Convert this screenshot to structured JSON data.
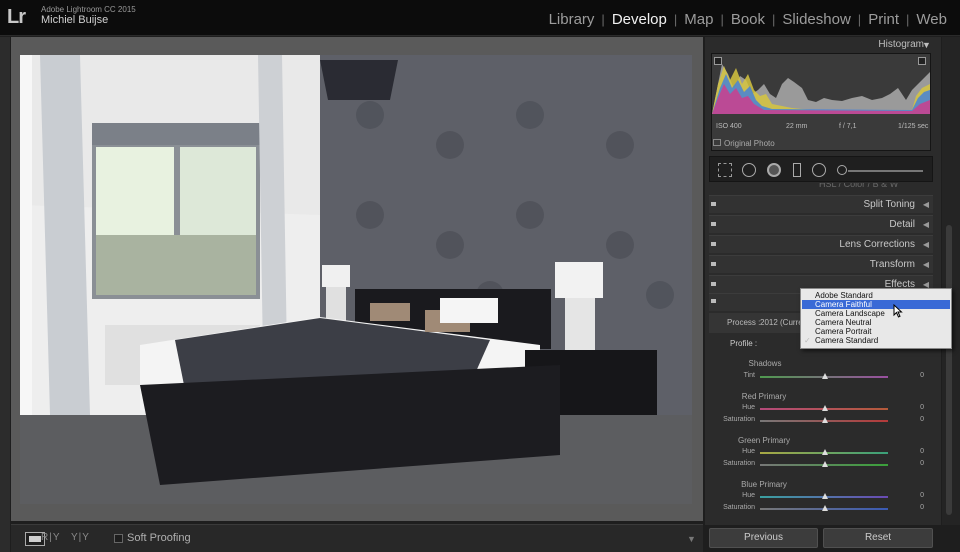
{
  "app": {
    "logo": "Lr",
    "name": "Adobe Lightroom CC 2015",
    "user": "Michiel Buijse"
  },
  "modules": [
    {
      "label": "Library",
      "active": false
    },
    {
      "label": "Develop",
      "active": true
    },
    {
      "label": "Map",
      "active": false
    },
    {
      "label": "Book",
      "active": false
    },
    {
      "label": "Slideshow",
      "active": false
    },
    {
      "label": "Print",
      "active": false
    },
    {
      "label": "Web",
      "active": false
    }
  ],
  "module_separator": "|",
  "toolbar": {
    "ry_label": "R|Y",
    "yy_label": "Y|Y",
    "soft_proofing": "Soft Proofing"
  },
  "histogram": {
    "title": "Histogram",
    "iso": "ISO 400",
    "focal": "22 mm",
    "aperture": "f / 7,1",
    "shutter": "1/125 sec",
    "original_photo": "Original Photo"
  },
  "hsl_tabs": "HSL  /  Color  /  B & W",
  "sections": [
    "Split Toning",
    "Detail",
    "Lens Corrections",
    "Transform",
    "Effects"
  ],
  "calibration": {
    "process_label": "Process :",
    "process_value": "2012 (Current)",
    "profile_label": "Profile :",
    "shadows_title": "Shadows",
    "tint_label": "Tint",
    "tint_value": "0",
    "red_title": "Red Primary",
    "red_hue_label": "Hue",
    "red_hue_value": "0",
    "red_sat_label": "Saturation",
    "red_sat_value": "0",
    "green_title": "Green Primary",
    "green_hue_label": "Hue",
    "green_hue_value": "0",
    "green_sat_label": "Saturation",
    "green_sat_value": "0",
    "blue_title": "Blue Primary",
    "blue_hue_label": "Hue",
    "blue_hue_value": "0",
    "blue_sat_label": "Saturation",
    "blue_sat_value": "0"
  },
  "profile_dropdown": {
    "options": [
      "Adobe Standard",
      "Camera Faithful",
      "Camera Landscape",
      "Camera Neutral",
      "Camera Portrait",
      "Camera Standard"
    ],
    "highlighted": "Camera Faithful",
    "selected": "Camera Standard",
    "check": "✓"
  },
  "buttons": {
    "previous": "Previous",
    "reset": "Reset"
  },
  "colors": {
    "accent_highlight": "#3a6ad6",
    "panel_bg": "#2b2b2b",
    "top_bar": "#0c0c0c"
  }
}
